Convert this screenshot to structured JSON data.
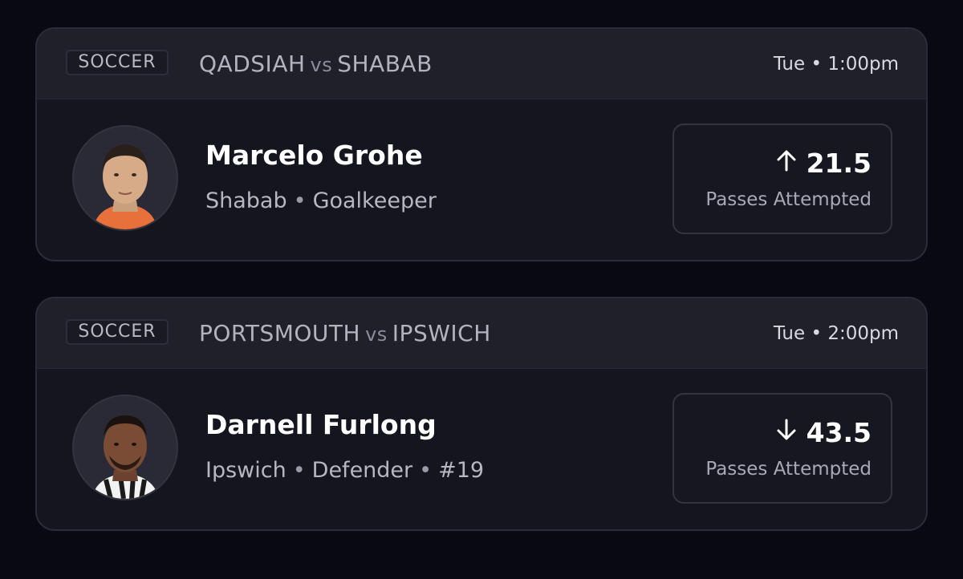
{
  "cards": [
    {
      "sport": "SOCCER",
      "team_a": "QADSIAH",
      "vs": "vs",
      "team_b": "SHABAB",
      "time": "Tue • 1:00pm",
      "player": {
        "name": "Marcelo Grohe",
        "team": "Shabab",
        "position": "Goalkeeper",
        "jersey": ""
      },
      "prop": {
        "direction": "up",
        "direction_icon": "arrow-up-icon",
        "line": "21.5",
        "stat": "Passes Attempted"
      },
      "colors": {
        "jersey": "#e8703a"
      }
    },
    {
      "sport": "SOCCER",
      "team_a": "PORTSMOUTH",
      "vs": "vs",
      "team_b": "IPSWICH",
      "time": "Tue • 2:00pm",
      "player": {
        "name": "Darnell Furlong",
        "team": "Ipswich",
        "position": "Defender",
        "jersey": "#19"
      },
      "prop": {
        "direction": "down",
        "direction_icon": "arrow-down-icon",
        "line": "43.5",
        "stat": "Passes Attempted"
      },
      "colors": {
        "jersey": "#f2f2f2"
      }
    }
  ],
  "separator": "•",
  "theme": {
    "background": "#090913",
    "card": "#15151f",
    "header": "#20202b"
  }
}
